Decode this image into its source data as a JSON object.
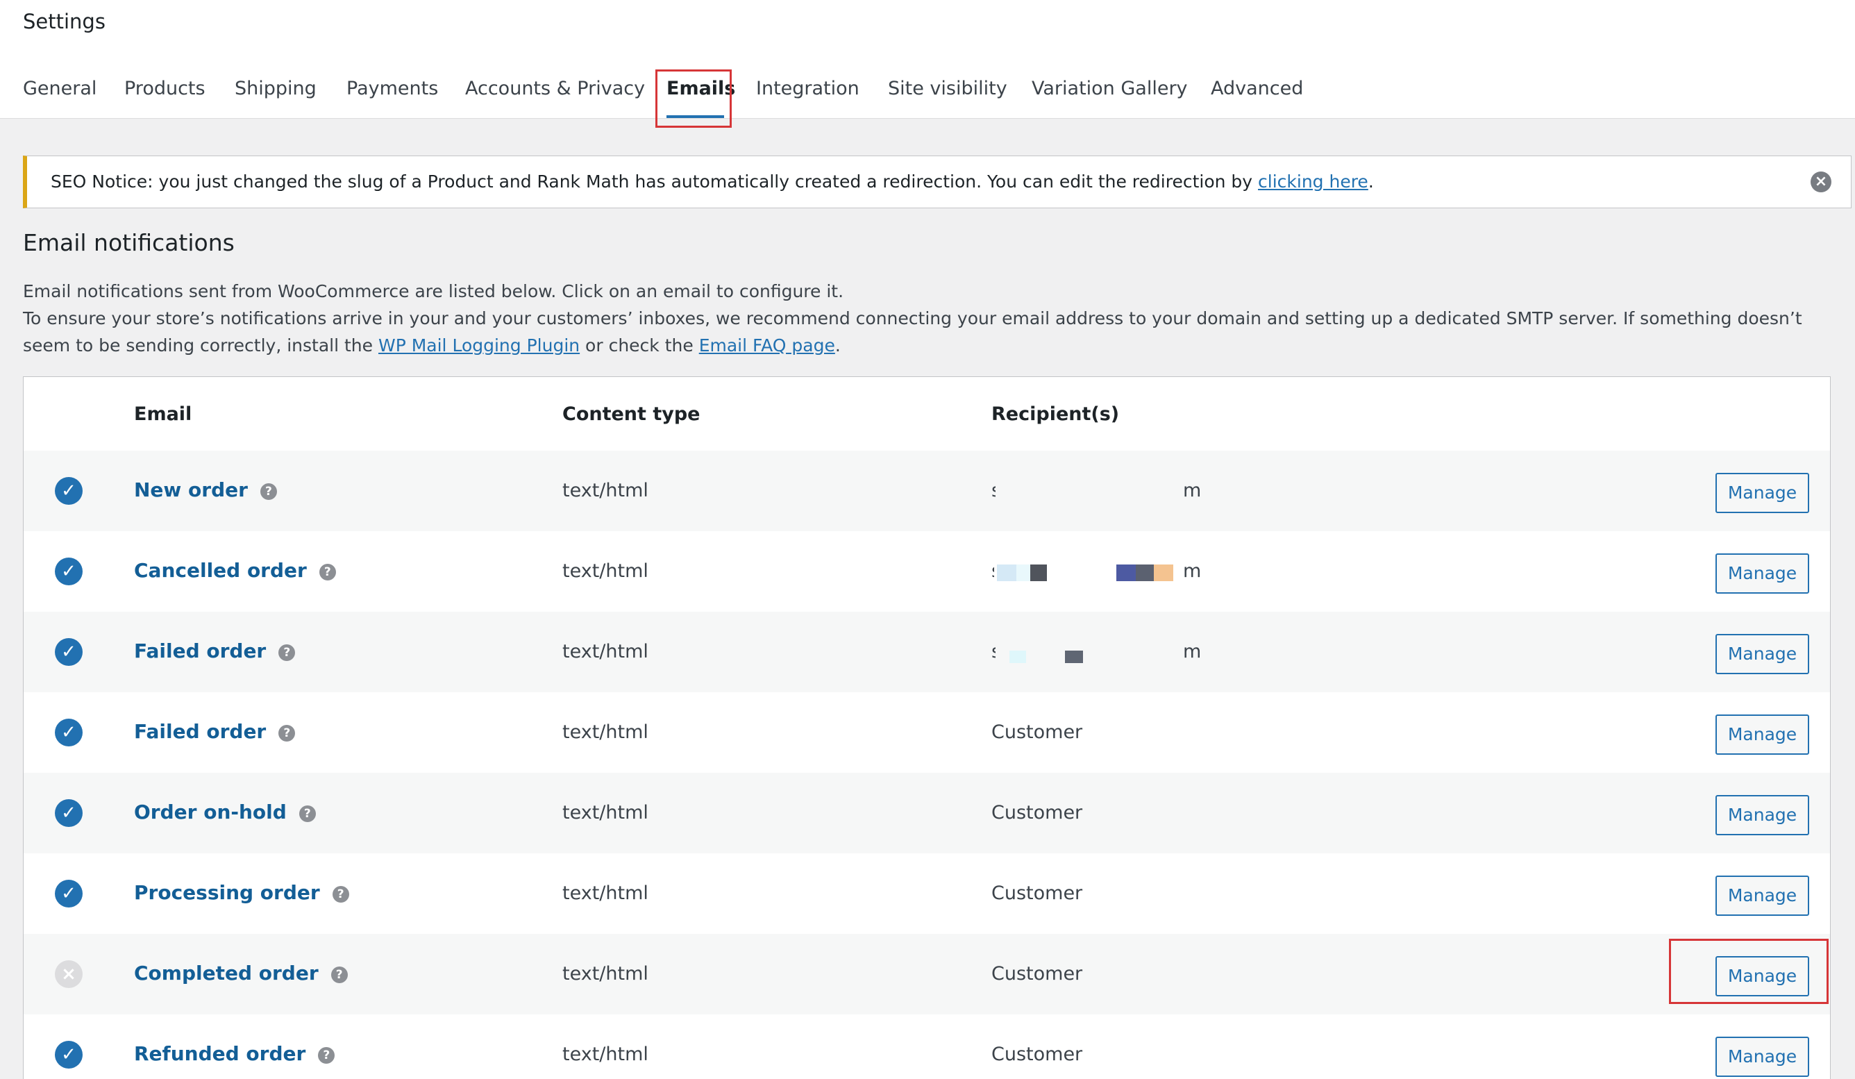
{
  "page": {
    "title": "Settings"
  },
  "tabs": [
    {
      "label": "General"
    },
    {
      "label": "Products"
    },
    {
      "label": "Shipping"
    },
    {
      "label": "Payments"
    },
    {
      "label": "Accounts & Privacy"
    },
    {
      "label": "Emails",
      "active": true
    },
    {
      "label": "Integration"
    },
    {
      "label": "Site visibility"
    },
    {
      "label": "Variation Gallery"
    },
    {
      "label": "Advanced"
    }
  ],
  "notice": {
    "text": "SEO Notice: you just changed the slug of a Product and Rank Math has automatically created a redirection. You can edit the redirection by ",
    "link": "clicking here",
    "end": ".",
    "accent_color": "#dba617"
  },
  "section": {
    "title": "Email notifications",
    "desc_line1": "Email notifications sent from WooCommerce are listed below. Click on an email to configure it.",
    "desc_line2": "To ensure your store’s notifications arrive in your and your customers’ inboxes, we recommend connecting your email address to your domain and setting up a dedicated SMTP server. If something doesn’t seem to be sending correctly, install the ",
    "link1": "WP Mail Logging Plugin",
    "mid": " or check the ",
    "link2": "Email FAQ page",
    "end": "."
  },
  "table": {
    "headers": {
      "email": "Email",
      "content_type": "Content type",
      "recipients": "Recipient(s)"
    },
    "rows": [
      {
        "enabled": true,
        "name": "New order",
        "content_type": "text/html",
        "recipient_start": "s",
        "recipient_end": "m",
        "manage": "Manage"
      },
      {
        "enabled": true,
        "name": "Cancelled order",
        "content_type": "text/html",
        "recipient_start": "s",
        "recipient_end": "m",
        "manage": "Manage"
      },
      {
        "enabled": true,
        "name": "Failed order",
        "content_type": "text/html",
        "recipient_start": "s",
        "recipient_end": "m",
        "manage": "Manage"
      },
      {
        "enabled": true,
        "name": "Failed order",
        "content_type": "text/html",
        "recipient": "Customer",
        "manage": "Manage"
      },
      {
        "enabled": true,
        "name": "Order on-hold",
        "content_type": "text/html",
        "recipient": "Customer",
        "manage": "Manage"
      },
      {
        "enabled": true,
        "name": "Processing order",
        "content_type": "text/html",
        "recipient": "Customer",
        "manage": "Manage"
      },
      {
        "enabled": false,
        "name": "Completed order",
        "content_type": "text/html",
        "recipient": "Customer",
        "manage": "Manage"
      },
      {
        "enabled": true,
        "name": "Refunded order",
        "content_type": "text/html",
        "recipient": "Customer",
        "manage": "Manage"
      }
    ]
  },
  "icons": {
    "enabled": "check-circle-icon",
    "disabled": "x-circle-icon",
    "help": "help-icon",
    "dismiss": "dismiss-icon"
  },
  "colors": {
    "link": "#2271b1",
    "highlight": "#d63638"
  }
}
